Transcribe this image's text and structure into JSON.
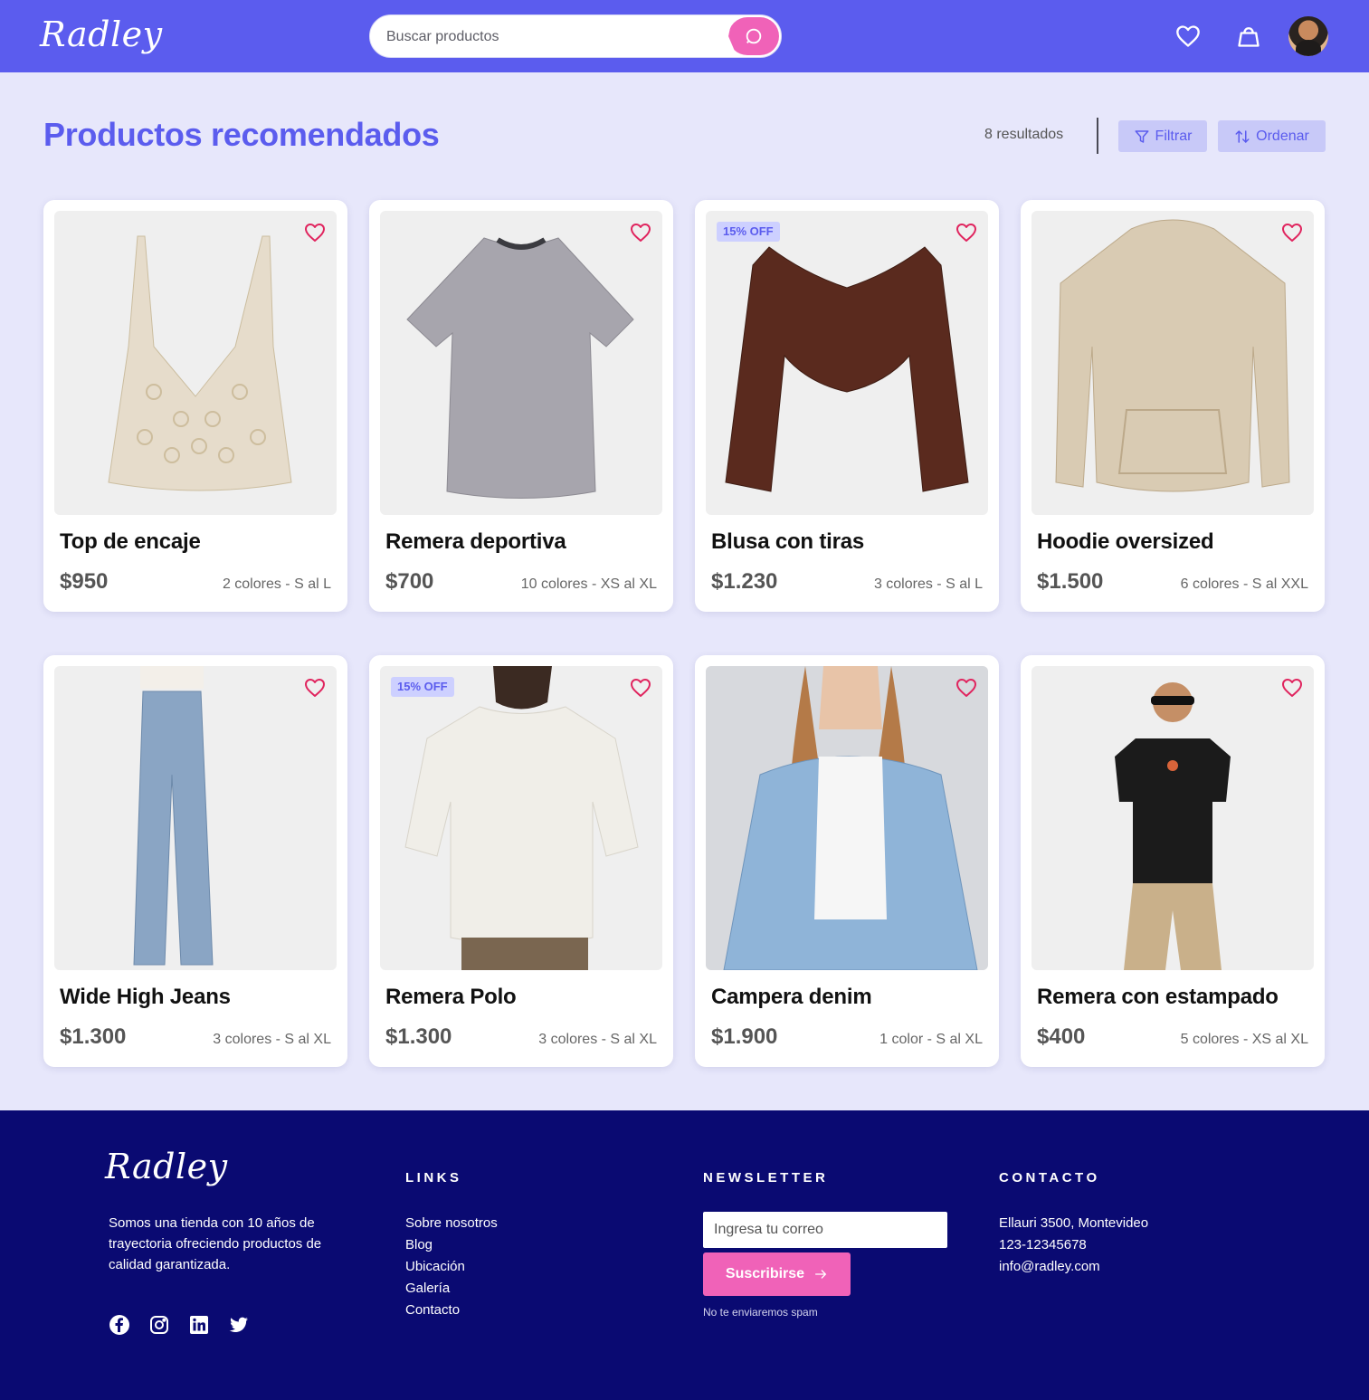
{
  "header": {
    "logo": "Radley",
    "search_placeholder": "Buscar productos"
  },
  "main": {
    "title": "Productos recomendados",
    "results": "8 resultados",
    "filter_label": "Filtrar",
    "order_label": "Ordenar"
  },
  "products": [
    {
      "name": "Top de encaje",
      "price": "$950",
      "meta": "2 colores - S al L",
      "badge": ""
    },
    {
      "name": "Remera deportiva",
      "price": "$700",
      "meta": "10 colores - XS al XL",
      "badge": ""
    },
    {
      "name": "Blusa con tiras",
      "price": "$1.230",
      "meta": "3 colores - S al L",
      "badge": "15% OFF"
    },
    {
      "name": "Hoodie oversized",
      "price": "$1.500",
      "meta": "6 colores - S al XXL",
      "badge": ""
    },
    {
      "name": "Wide High Jeans",
      "price": "$1.300",
      "meta": "3 colores - S al XL",
      "badge": ""
    },
    {
      "name": "Remera Polo",
      "price": "$1.300",
      "meta": "3 colores - S al XL",
      "badge": "15% OFF"
    },
    {
      "name": "Campera denim",
      "price": "$1.900",
      "meta": "1 color - S al XL",
      "badge": ""
    },
    {
      "name": "Remera con estampado",
      "price": "$400",
      "meta": "5 colores - XS al XL",
      "badge": ""
    }
  ],
  "footer": {
    "logo": "Radley",
    "about": "Somos una tienda con 10 años de trayectoria ofreciendo productos de calidad garantizada.",
    "links_heading": "LINKS",
    "links": [
      "Sobre nosotros",
      "Blog",
      "Ubicación",
      "Galería",
      "Contacto"
    ],
    "newsletter_heading": "NEWSLETTER",
    "newsletter_placeholder": "Ingresa tu correo",
    "subscribe_label": "Suscribirse",
    "newsletter_note": "No te enviaremos spam",
    "contact_heading": "CONTACTO",
    "contact": [
      "Ellauri 3500, Montevideo",
      "123-12345678",
      "info@radley.com"
    ]
  },
  "colors": {
    "primary": "#5b5cee",
    "accent": "#f062b8",
    "background": "#e7e7fb",
    "footer": "#0a0a72",
    "favorite": "#e0245e"
  },
  "icons": [
    "logo",
    "search-icon",
    "heart-icon",
    "bag-icon",
    "avatar",
    "filter-icon",
    "sort-icon",
    "facebook-icon",
    "instagram-icon",
    "linkedin-icon",
    "twitter-icon",
    "arrow-right-icon"
  ]
}
